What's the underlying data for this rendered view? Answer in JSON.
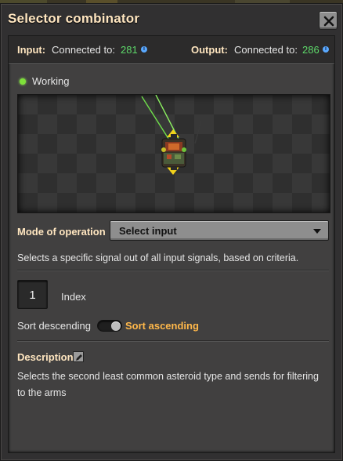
{
  "window": {
    "title": "Selector combinator",
    "close_icon": "close-icon"
  },
  "connections": {
    "input_label": "Input:",
    "input_text": "Connected to:",
    "input_count": "281",
    "output_label": "Output:",
    "output_text": "Connected to:",
    "output_count": "286",
    "info_icon": "info-icon"
  },
  "status": {
    "text": "Working",
    "color": "#7ee03a"
  },
  "preview": {
    "entity": "selector-combinator",
    "wire_color": "#7ee03a"
  },
  "mode": {
    "label": "Mode of operation",
    "selected": "Select input",
    "description": "Selects a specific signal out of all input signals, based on criteria."
  },
  "index": {
    "value": "1",
    "label": "Index"
  },
  "sort": {
    "descending_label": "Sort descending",
    "ascending_label": "Sort ascending",
    "selected": "ascending"
  },
  "description": {
    "title": "Description",
    "text": "Selects the second least common asteroid type and sends for filtering to the arms"
  },
  "colors": {
    "heading": "#ffe6c0",
    "count": "#5ed96a",
    "selected_option": "#ffb84a"
  }
}
